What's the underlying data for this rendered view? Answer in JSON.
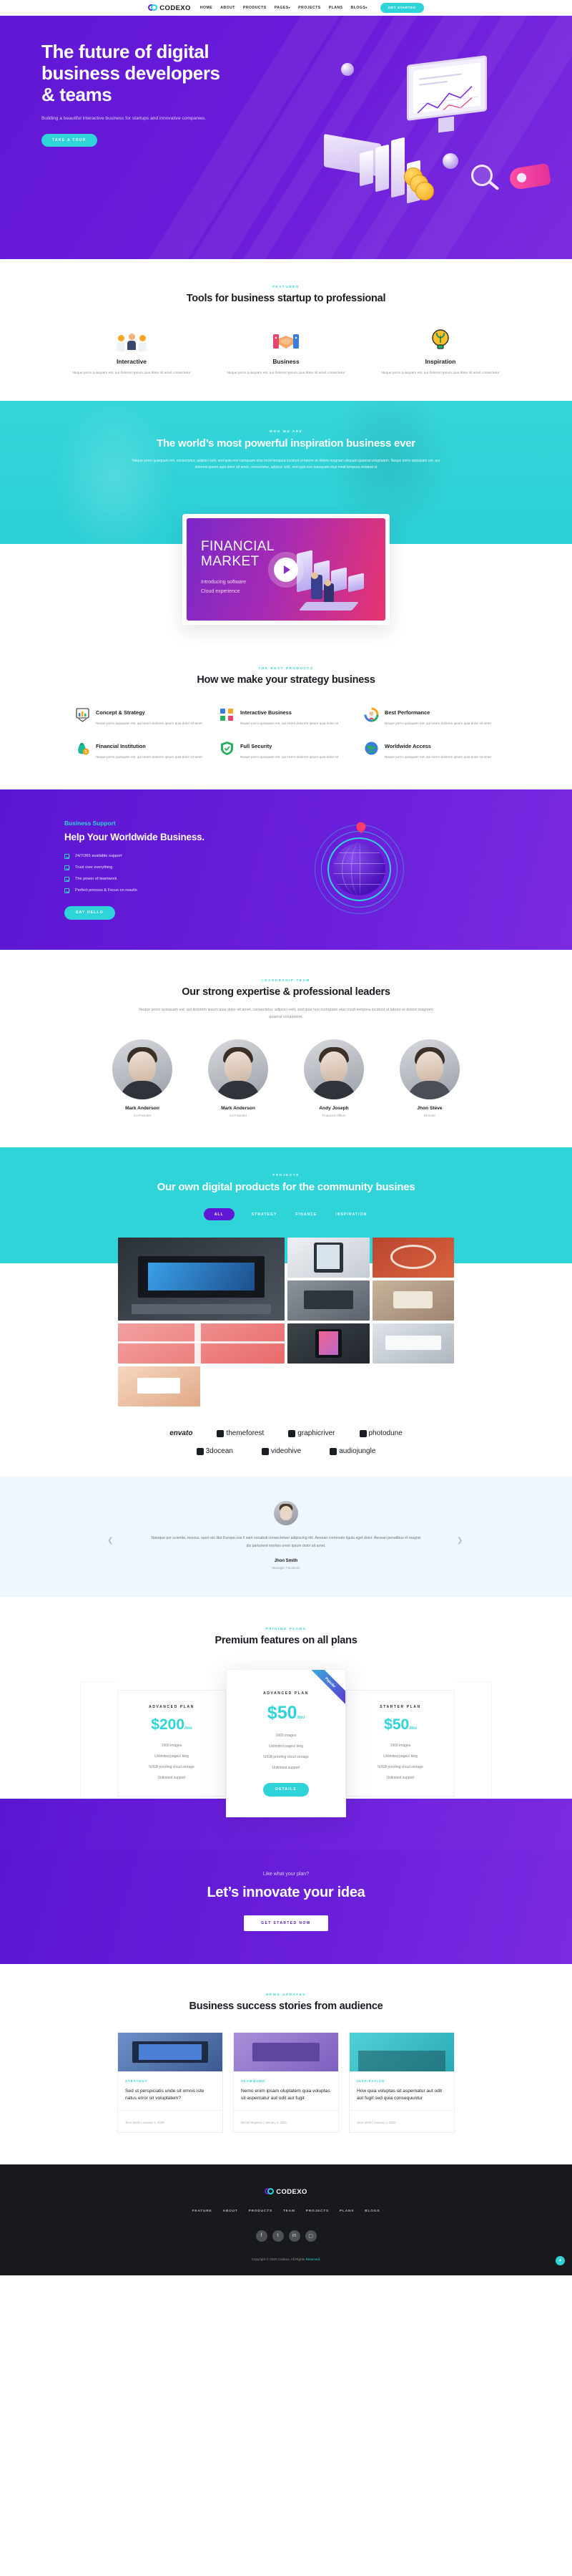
{
  "brand": {
    "name": "CODEXO"
  },
  "header": {
    "nav": [
      {
        "label": "HOME",
        "caret": false
      },
      {
        "label": "ABOUT",
        "caret": false
      },
      {
        "label": "PRODUCTS",
        "caret": false
      },
      {
        "label": "PAGES",
        "caret": true
      },
      {
        "label": "PROJECTS",
        "caret": false
      },
      {
        "label": "PLANS",
        "caret": false
      },
      {
        "label": "BLOGS",
        "caret": true
      }
    ],
    "cta": "GET STARTED"
  },
  "hero": {
    "title": "The future of digital business developers & teams",
    "subtitle": "Building a beautiful interactive business for startups and innovative companies.",
    "button": "TAKE A TOUR"
  },
  "featured": {
    "tag": "FEATURED",
    "title": "Tools for business startup to professional",
    "cards": [
      {
        "icon": "people-icon",
        "title": "Interactive",
        "text": "Neque porro quisquam est, qui dolorem ipsum quia dolor sit amet consectetur"
      },
      {
        "icon": "handshake-icon",
        "title": "Business",
        "text": "Neque porro quisquam est, qui dolorem ipsum quia dolor sit amet consectetur"
      },
      {
        "icon": "lightbulb-icon",
        "title": "Inspiration",
        "text": "Neque porro quisquam est, qui dolorem ipsum quia dolor sit amet consectetur"
      }
    ]
  },
  "whoweare": {
    "tag": "WHO WE ARE",
    "title": "The world’s most powerful inspiration business ever",
    "text": "Neque porro quisquam est, consectetur, adipisci velit, sed quia non numquam eius modi tempora incidunt ut labore et dolore magnam aliquam quaerat voluptatem. Neque porro quisquam est, qui dolorem ipsum quia dolor sit amet, consectetur, adipisci velit, sed quia non numquam eius modi tempora incidunt ut"
  },
  "video": {
    "line1": "FINANCIAL",
    "line2": "MARKET",
    "sub1": "Introducing software",
    "sub2": "Cloud experience",
    "play": "play-icon"
  },
  "bestproducts": {
    "tag": "THE BEST PRODUCTS",
    "title": "How we make your strategy business",
    "items": [
      {
        "icon": "chart-board-icon",
        "title": "Concept & Strategy",
        "text": "Neque porro quisquam est, qui lorem dolorem ipsum quia dolor sit amet"
      },
      {
        "icon": "people-group-icon",
        "title": "Interactive Business",
        "text": "Neque porro quisquam est, qui lorem dolorem ipsum quia dolor sit"
      },
      {
        "icon": "performance-icon",
        "title": "Best Performance",
        "text": "Neque porro quisquam est, qui lorem dolorem ipsum quia dolor sit amet"
      },
      {
        "icon": "money-bag-icon",
        "title": "Financial Institution",
        "text": "Neque porro quisquam est, qui lorem dolorem ipsum quia dolor sit amet"
      },
      {
        "icon": "shield-icon",
        "title": "Full Security",
        "text": "Neque porro quisquam est, qui lorem dolorem ipsum quia dolor sit"
      },
      {
        "icon": "globe-icon",
        "title": "Worldwide Access",
        "text": "Neque porro quisquam est, qui lorem dolorem ipsum quia dolor sit amet"
      }
    ]
  },
  "support": {
    "tag": "Business Support",
    "title": "Help Your Worldwide Business.",
    "list": [
      "24/7/365 available support",
      "Trust over everything",
      "The power of teamwork",
      "Perfect process & Focus on results"
    ],
    "button": "SAY HELLO"
  },
  "team": {
    "tag": "LEADERSHIP TEAM",
    "title": "Our strong expertise & professional leaders",
    "text": "Neque porro quisquam est, qui dolorem ipsum quia dolor sit amet, consectetur, adipisci velit, sed quia non numquam eius modi tempora incidunt ut labore et dolore magnam quaerat voluptatem.",
    "members": [
      {
        "name": "Mark Anderson",
        "role": "Co-Founder"
      },
      {
        "name": "Mark Anderson",
        "role": "Co-Founder"
      },
      {
        "name": "Andy Joseph",
        "role": "Financial Officer"
      },
      {
        "name": "Jhon Steve",
        "role": "Director"
      }
    ]
  },
  "projects": {
    "tag": "PROJECTS",
    "title": "Our own digital products for the community busines",
    "tabs": [
      {
        "label": "ALL",
        "active": true
      },
      {
        "label": "STRATEGY",
        "active": false
      },
      {
        "label": "FINANCE",
        "active": false
      },
      {
        "label": "INSPIRATION",
        "active": false
      }
    ]
  },
  "brands": {
    "row1": [
      "envato",
      "themeforest",
      "graphicriver",
      "photodune"
    ],
    "row2": [
      "3docean",
      "videohive",
      "audiojungle"
    ]
  },
  "testimonial": {
    "text": "Natoque por scientie, musica, sport etc litot Europa usa li sam vocabuli consectetuer adipiscing elit. Aenean commodo ligula eget dolor. Aenean penatibus et magnis dis parturient montes orem ipsum dolor sit amet.",
    "name": "Jhon Smith",
    "role": "Manager, Facebook",
    "prev": "chevron-left-icon",
    "next": "chevron-right-icon"
  },
  "pricing": {
    "tag": "PRICING PLANS",
    "title": "Premium features on all plans",
    "plans": [
      {
        "name": "ADVANCED PLAN",
        "price": "$200",
        "per": "/mo",
        "features": [
          "1000 images",
          "Unlimited pages/ blog",
          "50GB proofing cloud storage",
          "Unlimited support"
        ],
        "popular": false,
        "button": null
      },
      {
        "name": "ADVANCED PLAN",
        "price": "$50",
        "per": "/mo",
        "features": [
          "1000 images",
          "Unlimited pages/ blog",
          "50GB proofing cloud storage",
          "Unlimited support"
        ],
        "popular": true,
        "ribbon": "Popular",
        "button": "DETAILS"
      },
      {
        "name": "STARTER PLAN",
        "price": "$50",
        "per": "/mo",
        "features": [
          "1000 images",
          "Unlimited pages/ blog",
          "50GB proofing cloud storage",
          "Unlimited support"
        ],
        "popular": false,
        "button": null
      }
    ]
  },
  "cta": {
    "small": "Like what your plan?",
    "title": "Let’s innovate your idea",
    "button": "GET STARTED NOW"
  },
  "blog": {
    "tag": "NEWS UPDATES",
    "title": "Business success stories from audience",
    "posts": [
      {
        "cat": "STRATEGY",
        "title": "Sed ut perspiciatis unde sit omnis iste natus error sit voluptatem?",
        "meta": "Jhon Smith | January 1, 2020"
      },
      {
        "cat": "TEAMWORK",
        "title": "Nemo enim ipsam oluptatem quia voluptas sit aspernatur aut odit aut fugit",
        "meta": "Michel Regueiro | January 2, 2020"
      },
      {
        "cat": "INSPIRATION",
        "title": "How quia voluptas sit aspernatur aut odit aut fugit sed quia consequuntur",
        "meta": "Jhon Smith | January 3, 2020"
      }
    ]
  },
  "footer": {
    "nav": [
      "FEATURE",
      "ABOUT",
      "PRODUCTS",
      "TEAM",
      "PROJECTS",
      "PLANS",
      "BLOGS"
    ],
    "social": [
      "facebook-icon",
      "twitter-icon",
      "linkedin-icon",
      "instagram-icon"
    ],
    "copyright_prefix": "Copyright © 2020 Codexo. All Rights ",
    "copyright_link": "Reserved.",
    "scroll_top": "arrow-up-icon"
  }
}
